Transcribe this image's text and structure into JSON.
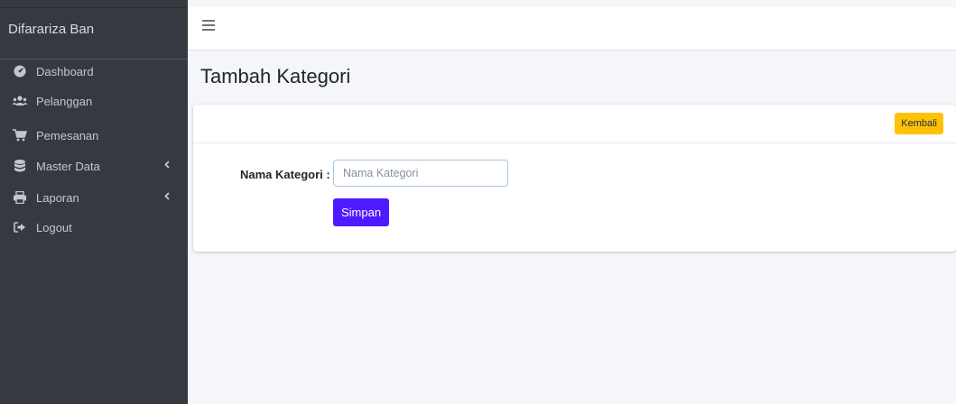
{
  "brand": {
    "name": "Difarariza Ban"
  },
  "sidebar": {
    "items": [
      {
        "label": "Dashboard",
        "icon": "tachometer-icon"
      },
      {
        "label": "Pelanggan",
        "icon": "users-icon"
      },
      {
        "label": "Pemesanan",
        "icon": "shopping-cart-icon"
      },
      {
        "label": "Master Data",
        "icon": "database-icon",
        "chevron": "‹"
      },
      {
        "label": "Laporan",
        "icon": "print-icon",
        "chevron": "‹"
      },
      {
        "label": "Logout",
        "icon": "sign-out-icon"
      }
    ]
  },
  "page": {
    "title": "Tambah Kategori"
  },
  "card": {
    "back_label": "Kembali",
    "field_label": "Nama Kategori :",
    "field_placeholder": "Nama Kategori",
    "field_value": "",
    "save_label": "Simpan"
  },
  "colors": {
    "sidebar_bg": "#343a40",
    "accent_warning": "#ffc107",
    "primary_button": "#4f1aff"
  }
}
